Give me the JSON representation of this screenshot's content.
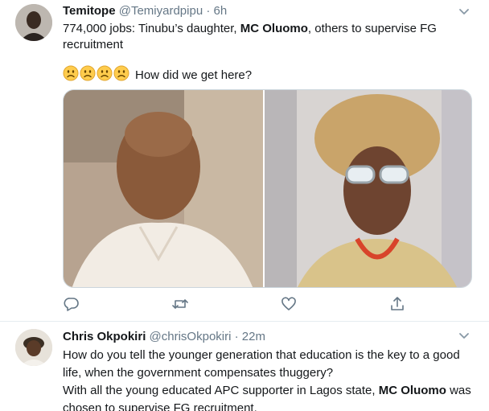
{
  "tweet1": {
    "name": "Temitope",
    "handle": "@Temiyardpipu",
    "dot": "·",
    "time": "6h",
    "text_part1": "774,000 jobs: Tinubu’s daughter, ",
    "text_bold": "MC Oluomo",
    "text_part2": ", others to supervise FG",
    "text_line2": "recruitment",
    "emoji_count": 4,
    "emoji_text": "How did we get here?",
    "actions": {
      "reply": "reply-icon",
      "retweet": "retweet-icon",
      "like": "heart-icon",
      "share": "share-icon"
    }
  },
  "tweet2": {
    "name": "Chris Okpokiri",
    "handle": "@chrisOkpokiri",
    "dot": "·",
    "time": "22m",
    "line1": "How do you tell the younger generation that education is the key to a good",
    "line2": "life, when the government compensates thuggery?",
    "line3_part1": "With all the young educated APC supporter in Lagos state, ",
    "line3_bold": "MC Oluomo",
    "line3_part2": " was",
    "line4": "chosen to supervise FG recruitment."
  },
  "colors": {
    "text": "#14171a",
    "secondary": "#657786",
    "border": "#e6ecf0",
    "emoji": "#ffcc4d"
  }
}
